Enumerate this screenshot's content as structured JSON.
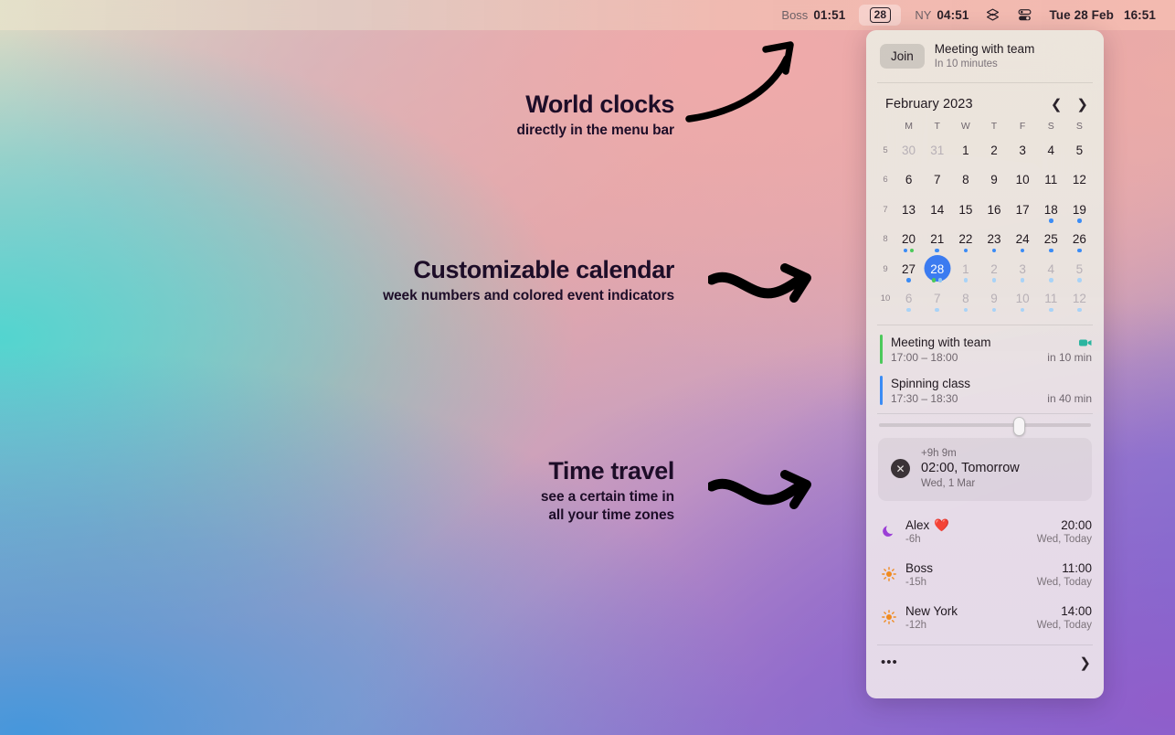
{
  "menubar": {
    "boss_label": "Boss",
    "boss_time": "01:51",
    "badge_day": "28",
    "ny_label": "NY",
    "ny_time": "04:51",
    "layers_icon": "layers-icon",
    "control_center_icon": "control-center-icon",
    "date": "Tue 28 Feb",
    "time": "16:51"
  },
  "panel": {
    "join": {
      "button_label": "Join",
      "title": "Meeting with team",
      "subtitle": "In 10 minutes"
    },
    "calendar": {
      "month_label": "February 2023",
      "prev_icon": "chevron-left-icon",
      "next_icon": "chevron-right-icon",
      "weekday_headers": [
        "M",
        "T",
        "W",
        "T",
        "F",
        "S",
        "S"
      ],
      "week_numbers": [
        "5",
        "6",
        "7",
        "8",
        "9",
        "10"
      ],
      "weeks": [
        [
          {
            "day": "30",
            "dim": true,
            "dots": []
          },
          {
            "day": "31",
            "dim": true,
            "dots": []
          },
          {
            "day": "1",
            "dim": false,
            "dots": []
          },
          {
            "day": "2",
            "dim": false,
            "dots": []
          },
          {
            "day": "3",
            "dim": false,
            "dots": []
          },
          {
            "day": "4",
            "dim": false,
            "dots": []
          },
          {
            "day": "5",
            "dim": false,
            "dots": []
          }
        ],
        [
          {
            "day": "6",
            "dim": false,
            "dots": []
          },
          {
            "day": "7",
            "dim": false,
            "dots": []
          },
          {
            "day": "8",
            "dim": false,
            "dots": []
          },
          {
            "day": "9",
            "dim": false,
            "dots": []
          },
          {
            "day": "10",
            "dim": false,
            "dots": []
          },
          {
            "day": "11",
            "dim": false,
            "dots": []
          },
          {
            "day": "12",
            "dim": false,
            "dots": []
          }
        ],
        [
          {
            "day": "13",
            "dim": false,
            "dots": []
          },
          {
            "day": "14",
            "dim": false,
            "dots": []
          },
          {
            "day": "15",
            "dim": false,
            "dots": []
          },
          {
            "day": "16",
            "dim": false,
            "dots": []
          },
          {
            "day": "17",
            "dim": false,
            "dots": []
          },
          {
            "day": "18",
            "dim": false,
            "dots": [
              "#3b8cf5"
            ]
          },
          {
            "day": "19",
            "dim": false,
            "dots": [
              "#3b8cf5"
            ]
          }
        ],
        [
          {
            "day": "20",
            "dim": false,
            "dots": [
              "#3b8cf5",
              "#4cc95b"
            ]
          },
          {
            "day": "21",
            "dim": false,
            "dots": [
              "#3b8cf5"
            ]
          },
          {
            "day": "22",
            "dim": false,
            "dots": [
              "#3b8cf5"
            ]
          },
          {
            "day": "23",
            "dim": false,
            "dots": [
              "#3b8cf5"
            ]
          },
          {
            "day": "24",
            "dim": false,
            "dots": [
              "#3b8cf5"
            ]
          },
          {
            "day": "25",
            "dim": false,
            "dots": [
              "#3b8cf5"
            ]
          },
          {
            "day": "26",
            "dim": false,
            "dots": [
              "#3b8cf5"
            ]
          }
        ],
        [
          {
            "day": "27",
            "dim": false,
            "today": false,
            "dots": [
              "#3b8cf5"
            ]
          },
          {
            "day": "28",
            "dim": false,
            "today": true,
            "dots": [
              "#4cc95b",
              "#8fc6f4"
            ]
          },
          {
            "day": "1",
            "dim": true,
            "dots": [
              "#a9d3f7"
            ]
          },
          {
            "day": "2",
            "dim": true,
            "dots": [
              "#a9d3f7"
            ]
          },
          {
            "day": "3",
            "dim": true,
            "dots": [
              "#a9d3f7"
            ]
          },
          {
            "day": "4",
            "dim": true,
            "dots": [
              "#a9d3f7"
            ]
          },
          {
            "day": "5",
            "dim": true,
            "dots": [
              "#a9d3f7"
            ]
          }
        ],
        [
          {
            "day": "6",
            "dim": true,
            "dots": [
              "#a9d3f7"
            ]
          },
          {
            "day": "7",
            "dim": true,
            "dots": [
              "#a9d3f7"
            ]
          },
          {
            "day": "8",
            "dim": true,
            "dots": [
              "#a9d3f7"
            ]
          },
          {
            "day": "9",
            "dim": true,
            "dots": [
              "#a9d3f7"
            ]
          },
          {
            "day": "10",
            "dim": true,
            "dots": [
              "#a9d3f7"
            ]
          },
          {
            "day": "11",
            "dim": true,
            "dots": [
              "#a9d3f7"
            ]
          },
          {
            "day": "12",
            "dim": true,
            "dots": [
              "#a9d3f7"
            ]
          }
        ]
      ]
    },
    "events": [
      {
        "title": "Meeting with team",
        "time": "17:00 – 18:00",
        "relative": "in 10 min",
        "color": "#4cc95b",
        "video_icon": "video-camera-icon",
        "has_video": true
      },
      {
        "title": "Spinning class",
        "time": "17:30 – 18:30",
        "relative": "in 40 min",
        "color": "#3b8cf5",
        "has_video": false
      }
    ],
    "time_travel": {
      "close_icon": "close-circle-icon",
      "offset": "+9h 9m",
      "time": "02:00, Tomorrow",
      "date": "Wed, 1 Mar",
      "slider_position_pct": 67
    },
    "clocks": [
      {
        "icon": "moon-icon",
        "name": "Alex",
        "emoji": "❤️",
        "offset": "-6h",
        "time": "20:00",
        "date": "Wed, Today"
      },
      {
        "icon": "sun-icon",
        "name": "Boss",
        "emoji": "",
        "offset": "-15h",
        "time": "11:00",
        "date": "Wed, Today"
      },
      {
        "icon": "sun-icon",
        "name": "New York",
        "emoji": "",
        "offset": "-12h",
        "time": "14:00",
        "date": "Wed, Today"
      }
    ],
    "footer": {
      "more_icon": "ellipsis-icon",
      "chevron_icon": "chevron-right-icon"
    }
  },
  "annotations": [
    {
      "id": "world-clocks",
      "heading": "World clocks",
      "subheading": "directly in the menu bar",
      "arrow_icon": "curved-arrow-up-right-icon"
    },
    {
      "id": "customizable-calendar",
      "heading": "Customizable calendar",
      "subheading": "week numbers and colored event indicators",
      "arrow_icon": "wavy-arrow-right-icon"
    },
    {
      "id": "time-travel",
      "heading": "Time travel",
      "subheading": "see a certain time in\nall your time zones",
      "arrow_icon": "wavy-arrow-right-icon"
    }
  ]
}
